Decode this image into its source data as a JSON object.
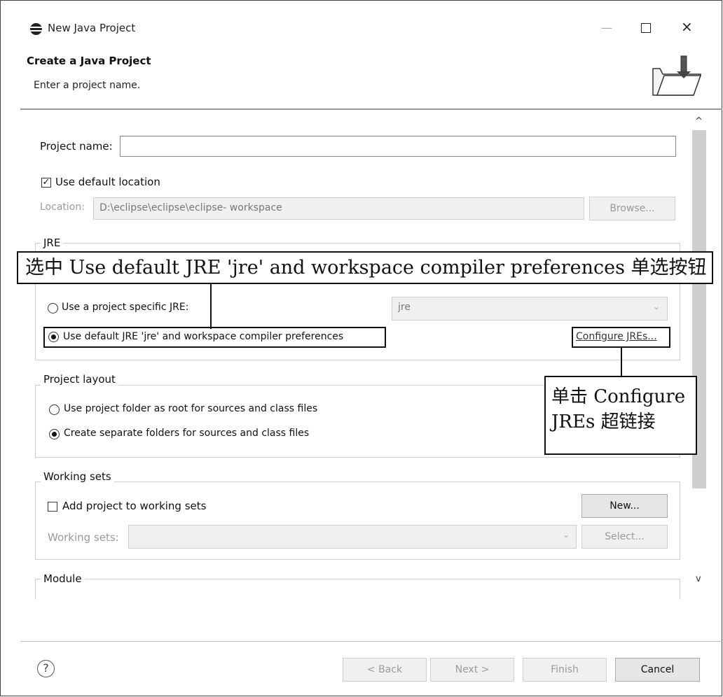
{
  "window": {
    "title": "New Java Project",
    "minimize": "—",
    "close": "×"
  },
  "header": {
    "title": "Create a Java Project",
    "subtitle": "Enter a project name."
  },
  "form": {
    "project_name_label": "Project name:",
    "project_name_value": "",
    "use_default_location": {
      "label": "Use default location",
      "checked": true
    },
    "location_label": "Location:",
    "location_value": "D:\\eclipse\\eclipse\\eclipse- workspace",
    "browse_label": "Browse..."
  },
  "jre": {
    "group_title": "JRE",
    "specific_jre_label": "Use a project specific JRE:",
    "specific_jre_value": "jre",
    "default_jre_label": "Use default JRE 'jre' and workspace compiler preferences",
    "configure_link": "Configure JREs..."
  },
  "project_layout": {
    "group_title": "Project layout",
    "option_root": "Use project folder as root for sources and class files",
    "option_separate": "Create separate folders for sources and class files"
  },
  "working_sets": {
    "group_title": "Working sets",
    "add_label": "Add project to working sets",
    "new_label": "New...",
    "sets_label": "Working sets:",
    "select_label": "Select..."
  },
  "module": {
    "group_title": "Module"
  },
  "footer": {
    "help": "?",
    "back": "< Back",
    "next": "Next >",
    "finish": "Finish",
    "cancel": "Cancel"
  },
  "annotations": {
    "callout_top": "选中 Use default JRE 'jre' and workspace compiler preferences 单选按钮",
    "callout_right_line1": "单击 Configure",
    "callout_right_line2": "JREs 超链接"
  },
  "icons": [
    "eclipse-icon",
    "maximize-icon",
    "folder-icon",
    "checkbox-checked-icon",
    "radio-icon",
    "help-icon",
    "scroll-up-icon",
    "scroll-down-icon",
    "dropdown-arrow-icon"
  ]
}
